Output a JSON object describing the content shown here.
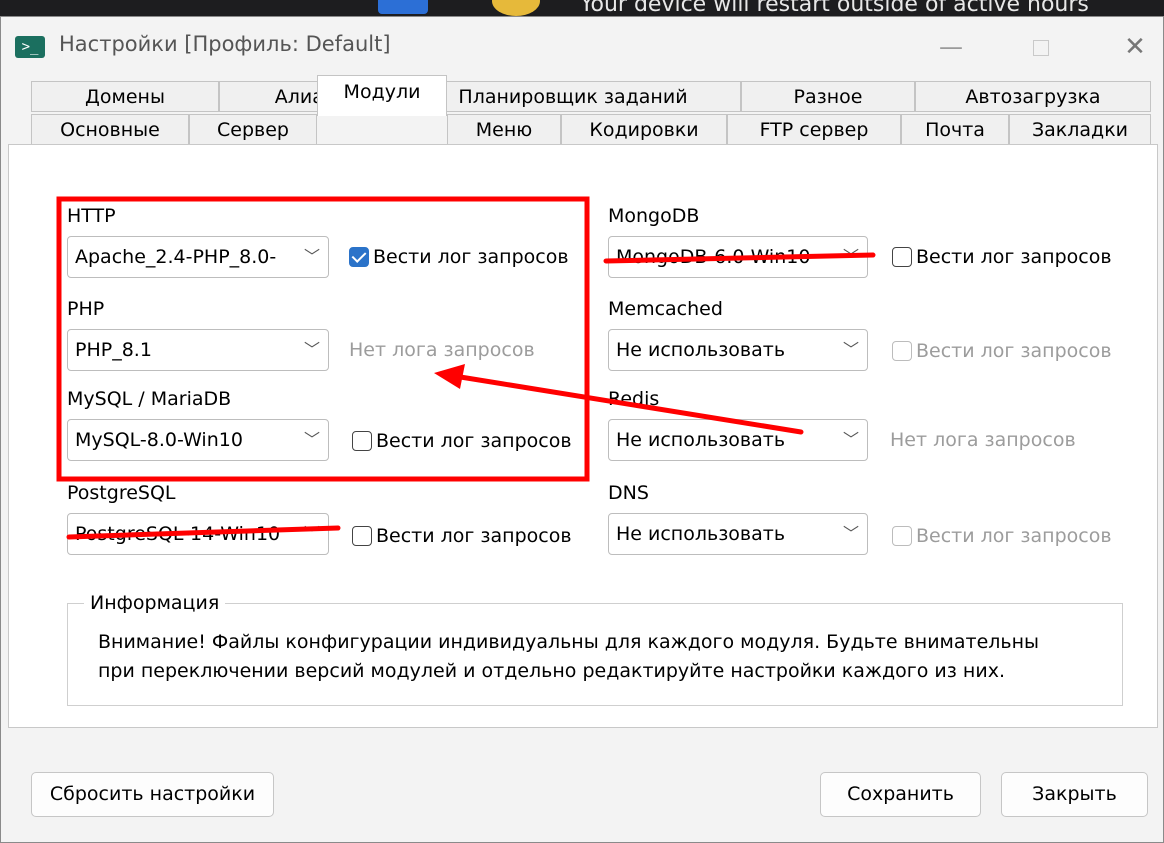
{
  "backdrop": {
    "notification_text": "Your device will restart outside of active hours"
  },
  "window": {
    "title": "Настройки [Профиль: Default]",
    "minimize": "—",
    "close": "✕"
  },
  "tabs_row1": [
    "Домены",
    "Алиасы",
    "Планировщик заданий",
    "Разное",
    "Автозагрузка"
  ],
  "tabs_row2": [
    "Основные",
    "Сервер",
    "Модули",
    "Меню",
    "Кодировки",
    "FTP сервер",
    "Почта",
    "Закладки"
  ],
  "active_tab": "Модули",
  "modules": {
    "http": {
      "label": "HTTP",
      "value": "Apache_2.4-PHP_8.0-",
      "log_label": "Вести лог запросов",
      "log_checked": true
    },
    "php": {
      "label": "PHP",
      "value": "PHP_8.1",
      "no_log": "Нет лога запросов"
    },
    "mysql": {
      "label": "MySQL / MariaDB",
      "value": "MySQL-8.0-Win10",
      "log_label": "Вести лог запросов",
      "log_checked": false
    },
    "postgresql": {
      "label": "PostgreSQL",
      "value": "PostgreSQL-14-Win10",
      "log_label": "Вести лог запросов",
      "log_checked": false
    },
    "mongodb": {
      "label": "MongoDB",
      "value": "MongoDB-6.0-Win10",
      "log_label": "Вести лог запросов",
      "log_checked": false
    },
    "memcached": {
      "label": "Memcached",
      "value": "Не использовать",
      "log_label": "Вести лог запросов",
      "log_checked": false
    },
    "redis": {
      "label": "Redis",
      "value": "Не использовать",
      "no_log": "Нет лога запросов"
    },
    "dns": {
      "label": "DNS",
      "value": "Не использовать",
      "log_label": "Вести лог запросов",
      "log_checked": false
    }
  },
  "info": {
    "title": "Информация",
    "line1": "Внимание! Файлы конфигурации индивидуальны для каждого модуля. Будьте внимательны",
    "line2": "при переключении версий модулей и отдельно редактируйте настройки каждого из них."
  },
  "buttons": {
    "reset": "Сбросить настройки",
    "save": "Сохранить",
    "close": "Закрыть"
  },
  "colors": {
    "annotation_red": "#ff0000",
    "checkbox_blue": "#2b73c9"
  }
}
